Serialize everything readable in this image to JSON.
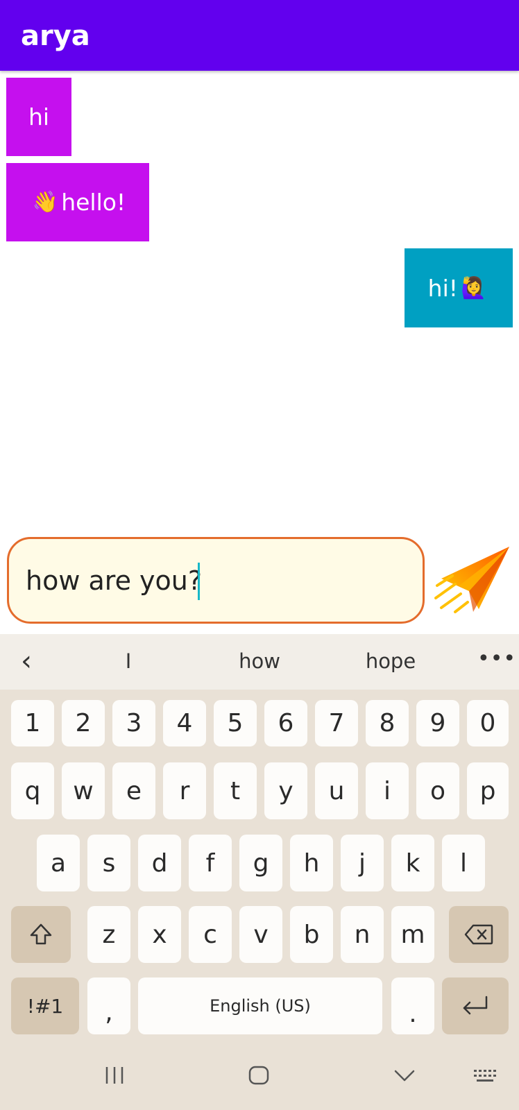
{
  "appbar": {
    "title": "arya",
    "color": "#6200ee"
  },
  "messages": [
    {
      "direction": "incoming",
      "text": "hi",
      "emoji": ""
    },
    {
      "direction": "incoming",
      "text": "hello!",
      "emoji": "👋"
    },
    {
      "direction": "outgoing",
      "text": "hi!",
      "emoji": "🙋‍♀️"
    }
  ],
  "colors": {
    "incoming": "#c510ee",
    "outgoing": "#00a0c2",
    "input_border": "#e46c2c",
    "input_bg": "#fffbe6"
  },
  "composer": {
    "value": "how are you?",
    "send_icon": "paper-plane-icon"
  },
  "keyboard": {
    "suggestions": [
      "I",
      "how",
      "hope"
    ],
    "more": "•••",
    "row_numbers": [
      "1",
      "2",
      "3",
      "4",
      "5",
      "6",
      "7",
      "8",
      "9",
      "0"
    ],
    "row_1": [
      "q",
      "w",
      "e",
      "r",
      "t",
      "y",
      "u",
      "i",
      "o",
      "p"
    ],
    "row_2": [
      "a",
      "s",
      "d",
      "f",
      "g",
      "h",
      "j",
      "k",
      "l"
    ],
    "row_3": [
      "z",
      "x",
      "c",
      "v",
      "b",
      "n",
      "m"
    ],
    "symbols": "!#1",
    "comma": ",",
    "space": "English (US)",
    "period": "."
  }
}
